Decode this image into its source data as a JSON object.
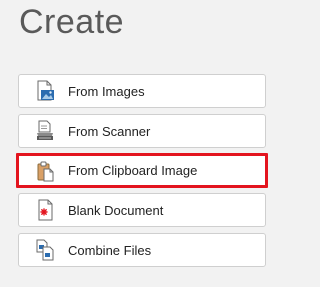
{
  "page": {
    "title": "Create"
  },
  "menu": {
    "items": [
      {
        "label": "From Images",
        "icon": "image-file-icon"
      },
      {
        "label": "From Scanner",
        "icon": "scanner-icon"
      },
      {
        "label": "From Clipboard Image",
        "icon": "clipboard-icon",
        "selected": true
      },
      {
        "label": "Blank Document",
        "icon": "blank-document-icon"
      },
      {
        "label": "Combine Files",
        "icon": "combine-files-icon"
      }
    ]
  },
  "colors": {
    "background": "#f2f2f2",
    "highlight": "#e3141e",
    "accent_blue": "#2b6cb0",
    "clipboard_tan": "#d9a066"
  }
}
